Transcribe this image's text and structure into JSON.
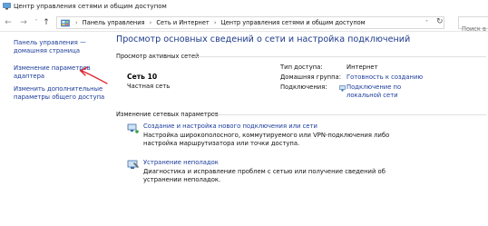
{
  "window": {
    "title": "Центр управления сетями и общим доступом"
  },
  "addressbar": {
    "back": "←",
    "forward": "→",
    "up": "↑",
    "crumbs": [
      "Панель управления",
      "Сеть и Интернет",
      "Центр управления сетями и общим доступом"
    ],
    "search_placeholder": "Поиск в п"
  },
  "sidebar": {
    "items": [
      {
        "label_l1": "Панель управления —",
        "label_l2": "домашняя страница"
      },
      {
        "label_l1": "Изменение параметров",
        "label_l2": "адаптера"
      },
      {
        "label_l1": "Изменить дополнительные",
        "label_l2": "параметры общего доступа"
      }
    ]
  },
  "main": {
    "title": "Просмотр основных сведений о сети и настройка подключений",
    "active_networks_header": "Просмотр активных сетей",
    "network": {
      "name": "Сеть  10",
      "type": "Частная сеть",
      "access_type_label": "Тип доступа:",
      "access_type_value": "Интернет",
      "homegroup_label": "Домашняя группа:",
      "homegroup_value": "Готовность к созданию",
      "connections_label": "Подключения:",
      "connections_value_l1": "Подключение по",
      "connections_value_l2": "локальной сети"
    },
    "change_settings_header": "Изменение сетевых параметров",
    "tasks": [
      {
        "link": "Создание и настройка нового подключения или сети",
        "desc": "Настройка широкополосного, коммутируемого или VPN-подключения либо настройка маршрутизатора или точки доступа."
      },
      {
        "link": "Устранение неполадок",
        "desc": "Диагностика и исправление проблем с сетью или получение сведений об устранении неполадок."
      }
    ]
  },
  "colors": {
    "link": "#1a3a99",
    "title": "#1e3a8a",
    "annotation_arrow": "#e0202a"
  }
}
